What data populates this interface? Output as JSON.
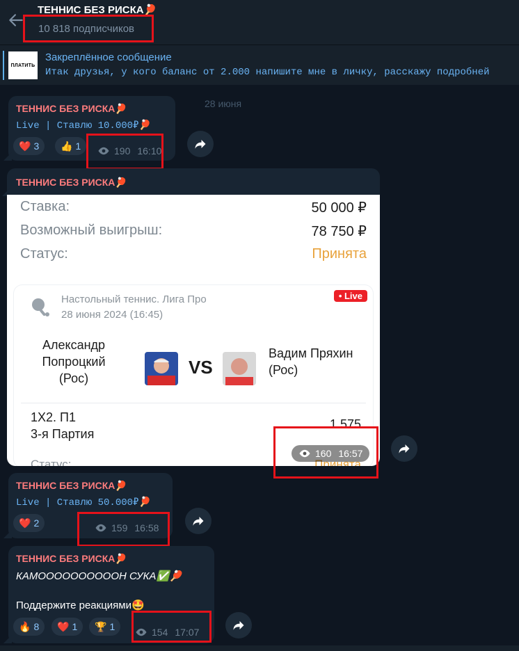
{
  "header": {
    "title": "ТЕННИС БЕЗ РИСКА🏓",
    "subscribers": "10 818 подписчиков"
  },
  "pinned": {
    "thumb_text": "ПЛАТИТЬ",
    "title": "Закреплённое сообщение",
    "text": "Итак друзья, у кого баланс от 2.000 напишите мне в личку, расскажу подробней"
  },
  "date_separator": "28 июня",
  "messages": [
    {
      "sender": "ТЕННИС БЕЗ РИСКА🏓",
      "text": "Live | Ставлю 10.000₽🏓",
      "reactions": [
        {
          "emoji": "❤️",
          "count": "3"
        },
        {
          "emoji": "👍",
          "count": "1"
        }
      ],
      "views": "190",
      "time": "16:10"
    },
    {
      "sender": "ТЕННИС БЕЗ РИСКА🏓",
      "bet": {
        "stake_label": "Ставка:",
        "stake_value": "50 000 ₽",
        "win_label": "Возможный выигрыш:",
        "win_value": "78 750 ₽",
        "status_label": "Статус:",
        "status_value": "Принята",
        "league": "Настольный теннис. Лига Про",
        "match_date": "28 июня 2024 (16:45)",
        "live_badge": "• Live",
        "player1_line1": "Александр",
        "player1_line2": "Попроцкий",
        "player1_line3": "(Рос)",
        "vs": "VS",
        "player2_line1": "Вадим Пряхин",
        "player2_line2": "(Рос)",
        "bet_type_line1": "1X2. П1",
        "bet_type_line2": "3-я Партия",
        "odds": "1.575",
        "status2_label": "Статус:",
        "status2_value": "Принята"
      },
      "views": "160",
      "time": "16:57"
    },
    {
      "sender": "ТЕННИС БЕЗ РИСКА🏓",
      "text": "Live | Ставлю 50.000₽🏓",
      "reactions": [
        {
          "emoji": "❤️",
          "count": "2"
        }
      ],
      "views": "159",
      "time": "16:58"
    },
    {
      "sender": "ТЕННИС БЕЗ РИСКА🏓",
      "text_italic": "КАМООООООООООН СУКА✅🏓",
      "text": "Поддержите реакциями🤩",
      "reactions": [
        {
          "emoji": "🔥",
          "count": "8"
        },
        {
          "emoji": "❤️",
          "count": "1"
        },
        {
          "emoji": "🏆",
          "count": "1"
        }
      ],
      "views": "154",
      "time": "17:07"
    }
  ],
  "colors": {
    "background": "#0e1621",
    "bubble": "#182533",
    "sender": "#fe7c7d",
    "link": "#6ab3f3",
    "accept": "#e8a23b",
    "highlight": "#e5121a"
  }
}
